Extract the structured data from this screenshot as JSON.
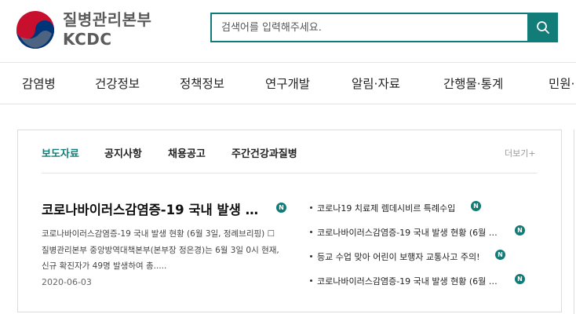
{
  "header": {
    "brand_ko": "질병관리본부",
    "brand_en": "KCDC",
    "search_placeholder": "검색어를 입력해주세요.",
    "accent_color": "#127d78"
  },
  "nav": [
    "감염병",
    "건강정보",
    "정책정보",
    "연구개발",
    "알림·자료",
    "간행물·통계",
    "민원·"
  ],
  "panel": {
    "tabs": [
      "보도자료",
      "공지사항",
      "채용공고",
      "주간건강과질병"
    ],
    "more_label": "더보기+",
    "featured": {
      "title": "코로나바이러스감염증-19 국내 발생 …",
      "badge": "N",
      "summary": [
        "코로나바이러스감염증-19 국내 발생 현황 (6월 3일, 정례브리핑) ☐",
        "질병관리본부 중앙방역대책본부(본부장 정은경)는 6월 3일 0시 현재,",
        "신규 확진자가 49명 발생하여 총....."
      ],
      "date": "2020-06-03"
    },
    "list": [
      {
        "text": "코로나19 치료제 렘데시비르 특례수입",
        "badge": "N"
      },
      {
        "text": "코로나바이러스감염증-19 국내 발생 현황 (6월 …",
        "badge": "N"
      },
      {
        "text": "등교 수업 맞아 어린이 보행자 교통사고 주의!",
        "badge": "N"
      },
      {
        "text": "코로나바이러스감염증-19 국내 발생 현황 (6월 …",
        "badge": "N"
      }
    ]
  }
}
